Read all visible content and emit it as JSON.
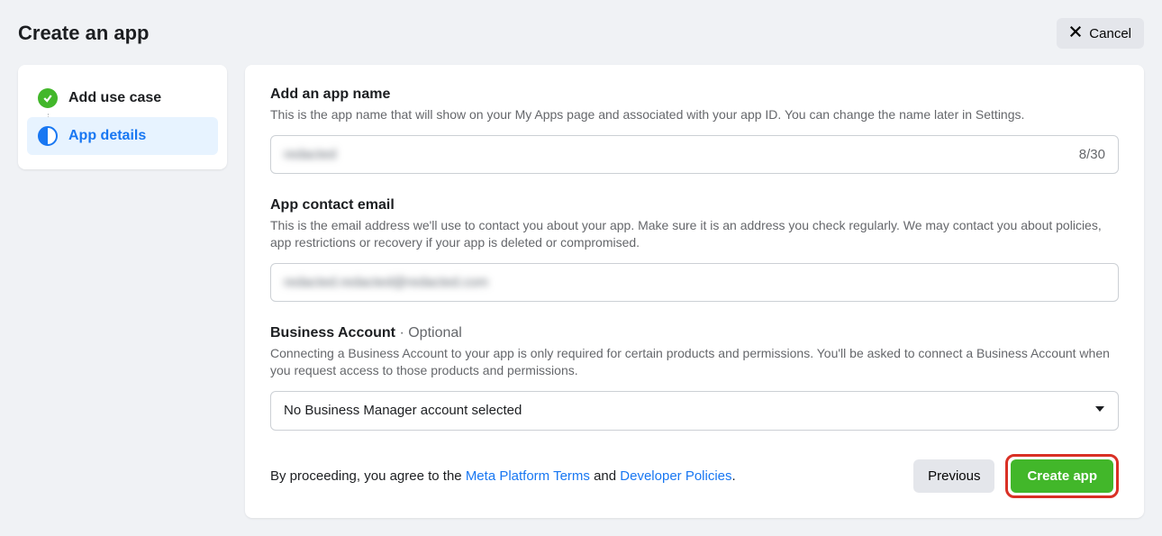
{
  "header": {
    "title": "Create an app",
    "cancel_label": "Cancel"
  },
  "sidebar": {
    "steps": [
      {
        "label": "Add use case",
        "state": "done"
      },
      {
        "label": "App details",
        "state": "active"
      }
    ]
  },
  "form": {
    "app_name": {
      "label": "Add an app name",
      "description": "This is the app name that will show on your My Apps page and associated with your app ID. You can change the name later in Settings.",
      "value": "redacted",
      "char_count": "8/30"
    },
    "contact_email": {
      "label": "App contact email",
      "description": "This is the email address we'll use to contact you about your app. Make sure it is an address you check regularly. We may contact you about policies, app restrictions or recovery if your app is deleted or compromised.",
      "value": "redacted.redacted@redacted.com"
    },
    "business_account": {
      "label": "Business Account",
      "optional": " · Optional",
      "description": "Connecting a Business Account to your app is only required for certain products and permissions. You'll be asked to connect a Business Account when you request access to those products and permissions.",
      "selected": "No Business Manager account selected"
    }
  },
  "footer": {
    "consent_prefix": "By proceeding, you agree to the ",
    "link_terms": "Meta Platform Terms",
    "consent_mid": " and ",
    "link_policies": "Developer Policies",
    "consent_suffix": ".",
    "previous_label": "Previous",
    "create_label": "Create app"
  }
}
